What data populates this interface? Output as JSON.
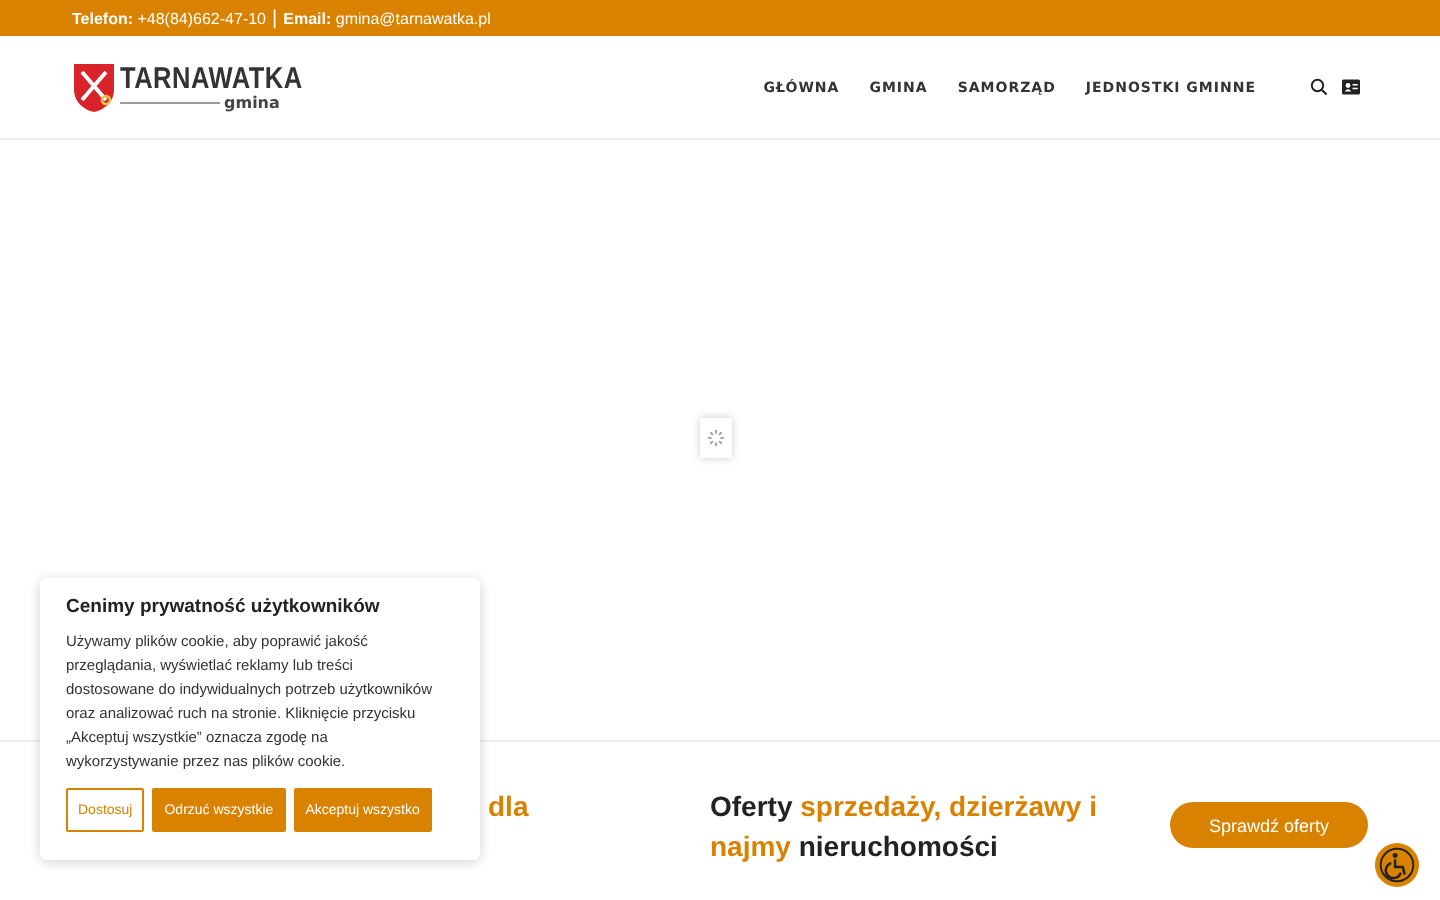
{
  "top_bar": {
    "phone_label": "Telefon:",
    "phone": "+48(84)662-47-10",
    "separator": "|",
    "email_label": "Email:",
    "email": "gmina@tarnawatka.pl"
  },
  "logo": {
    "name": "TARNAWATKA",
    "subtitle": "gmina"
  },
  "nav": [
    {
      "label": "GŁÓWNA"
    },
    {
      "label": "GMINA"
    },
    {
      "label": "SAMORZĄD"
    },
    {
      "label": "JEDNOSTKI GMINNE"
    }
  ],
  "offer": {
    "partial_heading": "dla",
    "heading": [
      {
        "text": "Oferty ",
        "highlight": false
      },
      {
        "text": "sprzedaży, dzierżawy i najmy",
        "highlight": true
      },
      {
        "text": " nieruchomości",
        "highlight": false
      }
    ],
    "button": "Sprawdź oferty"
  },
  "cookie": {
    "title": "Cenimy prywatność użytkowników",
    "text": "Używamy plików cookie, aby poprawić jakość przeglądania, wyświetlać reklamy lub treści dostosowane do indywidualnych potrzeb użytkowników oraz analizować ruch na stronie. Kliknięcie przycisku „Akceptuj wszystkie” oznacza zgodę na wykorzystywanie przez nas plików cookie.",
    "buttons": [
      {
        "label": "Dostosuj",
        "kind": "outline"
      },
      {
        "label": "Odrzuć wszystkie",
        "kind": "filled"
      },
      {
        "label": "Akceptuj wszystko",
        "kind": "filled"
      }
    ]
  }
}
